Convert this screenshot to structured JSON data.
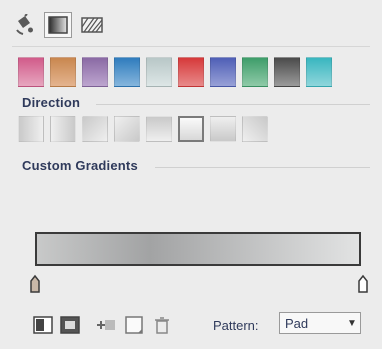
{
  "toolbar": {
    "buttons": [
      {
        "icon": "paint-bucket-icon",
        "active": false
      },
      {
        "icon": "gradient-icon",
        "active": true
      },
      {
        "icon": "pattern-icon",
        "active": false
      }
    ]
  },
  "swatches": [
    {
      "top": "#d15b8a",
      "bottom": "#e7a6bf"
    },
    {
      "top": "#c9874f",
      "bottom": "#e4b48f"
    },
    {
      "top": "#8a6aa4",
      "bottom": "#bda5cf"
    },
    {
      "top": "#2f7cbd",
      "bottom": "#86b6dd"
    },
    {
      "top": "#b8c7c7",
      "bottom": "#dde6e6"
    },
    {
      "top": "#d6393a",
      "bottom": "#e88a8a"
    },
    {
      "top": "#4f5fb6",
      "bottom": "#98a1d7"
    },
    {
      "top": "#3e9d6a",
      "bottom": "#8fcaa8"
    },
    {
      "top": "#4b4b4b",
      "bottom": "#9b9b9b"
    },
    {
      "top": "#39b6bf",
      "bottom": "#8fd6db"
    }
  ],
  "labels": {
    "direction": "Direction",
    "custom_gradients": "Custom Gradients"
  },
  "directions": [
    {
      "name": "dir-left",
      "grad": "linear-gradient(90deg,#c9c9c9,#efefef)"
    },
    {
      "name": "dir-right",
      "grad": "linear-gradient(270deg,#c9c9c9,#efefef)"
    },
    {
      "name": "dir-top-left",
      "grad": "linear-gradient(135deg,#c9c9c9,#efefef)"
    },
    {
      "name": "dir-bottom-right",
      "grad": "linear-gradient(315deg,#c9c9c9,#efefef)"
    },
    {
      "name": "dir-top",
      "grad": "linear-gradient(180deg,#c9c9c9,#efefef)"
    },
    {
      "name": "dir-radial",
      "grad": "radial-gradient(circle,#fafafa,#cfcfcf)",
      "selected": true
    },
    {
      "name": "dir-bottom",
      "grad": "linear-gradient(0deg,#c9c9c9,#efefef)"
    },
    {
      "name": "dir-top-right",
      "grad": "linear-gradient(225deg,#c9c9c9,#efefef)"
    }
  ],
  "pattern": {
    "label": "Pattern:",
    "value": "Pad"
  }
}
